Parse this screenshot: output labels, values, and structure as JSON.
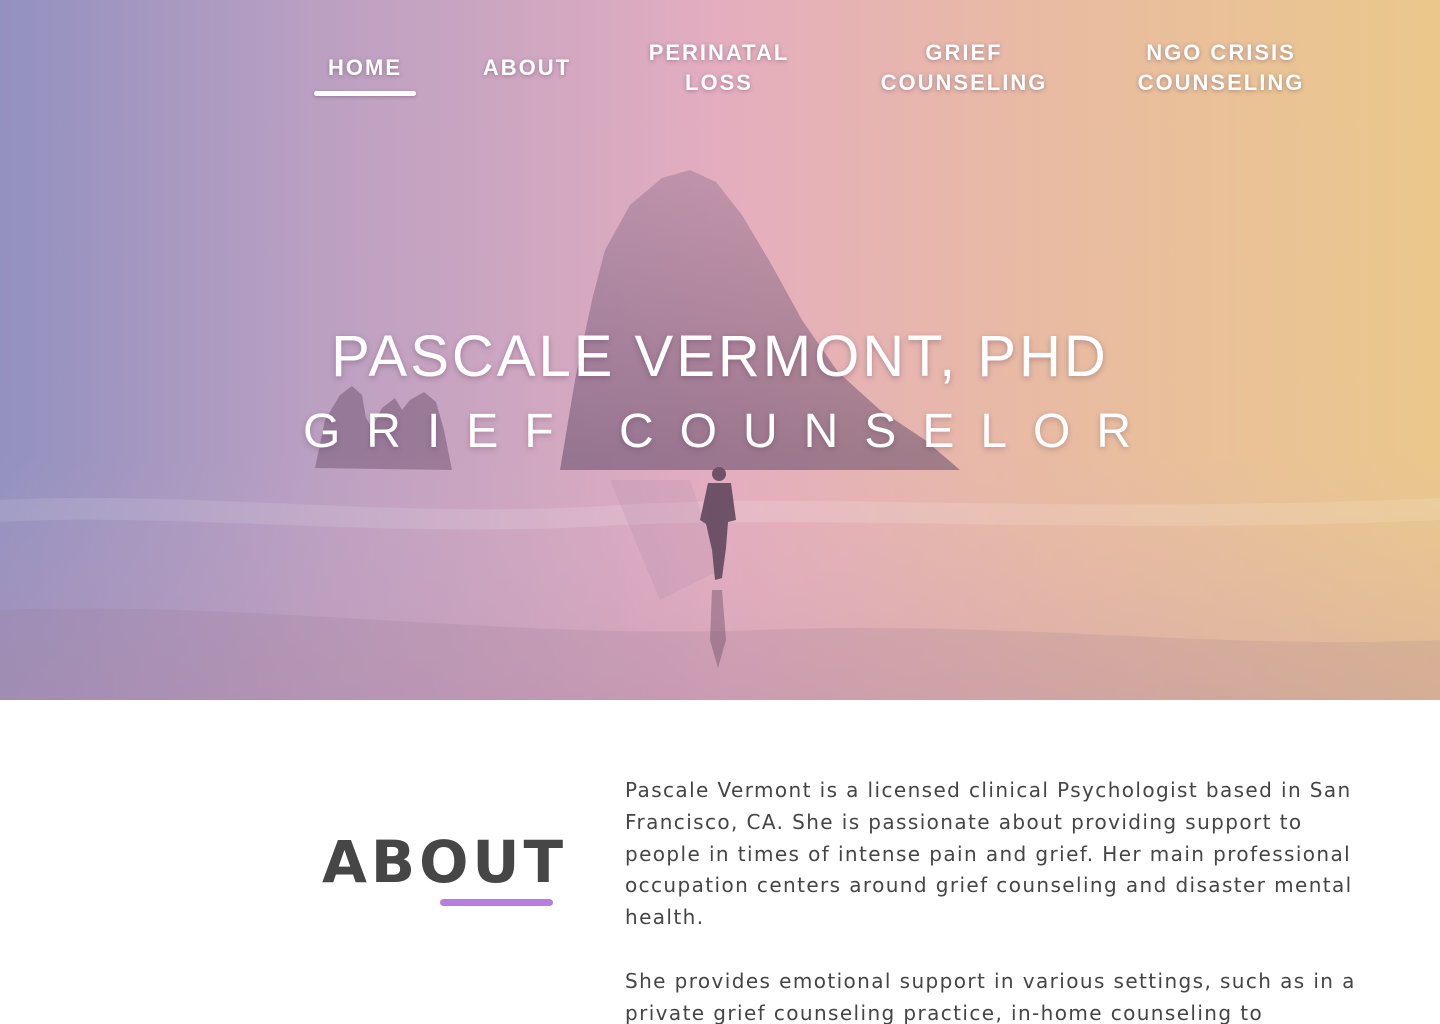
{
  "nav": {
    "items": [
      {
        "line1": "HOME",
        "line2": ""
      },
      {
        "line1": "ABOUT",
        "line2": ""
      },
      {
        "line1": "PERINATAL",
        "line2": "LOSS"
      },
      {
        "line1": "GRIEF",
        "line2": "COUNSELING"
      },
      {
        "line1": "NGO CRISIS",
        "line2": "COUNSELING"
      }
    ],
    "active": "HOME"
  },
  "hero": {
    "title": "PASCALE VERMONT, PHD",
    "subtitle": "GRIEF COUNSELOR"
  },
  "about": {
    "heading": "ABOUT",
    "paragraphs": [
      "Pascale Vermont is a licensed clinical Psychologist based in San Francisco, CA. She is passionate about providing support to people in times of intense pain and grief. Her main professional occupation centers around grief counseling and disaster mental health.",
      "She provides emotional support in various settings, such as in a private grief counseling practice, in-home counseling to"
    ]
  },
  "colors": {
    "accent_underline": "#b77ee0",
    "heading_text": "#464646",
    "body_text": "#454545",
    "hero_gradient": [
      "#9c9cc4",
      "#e6b0bf",
      "#e8c894"
    ]
  }
}
